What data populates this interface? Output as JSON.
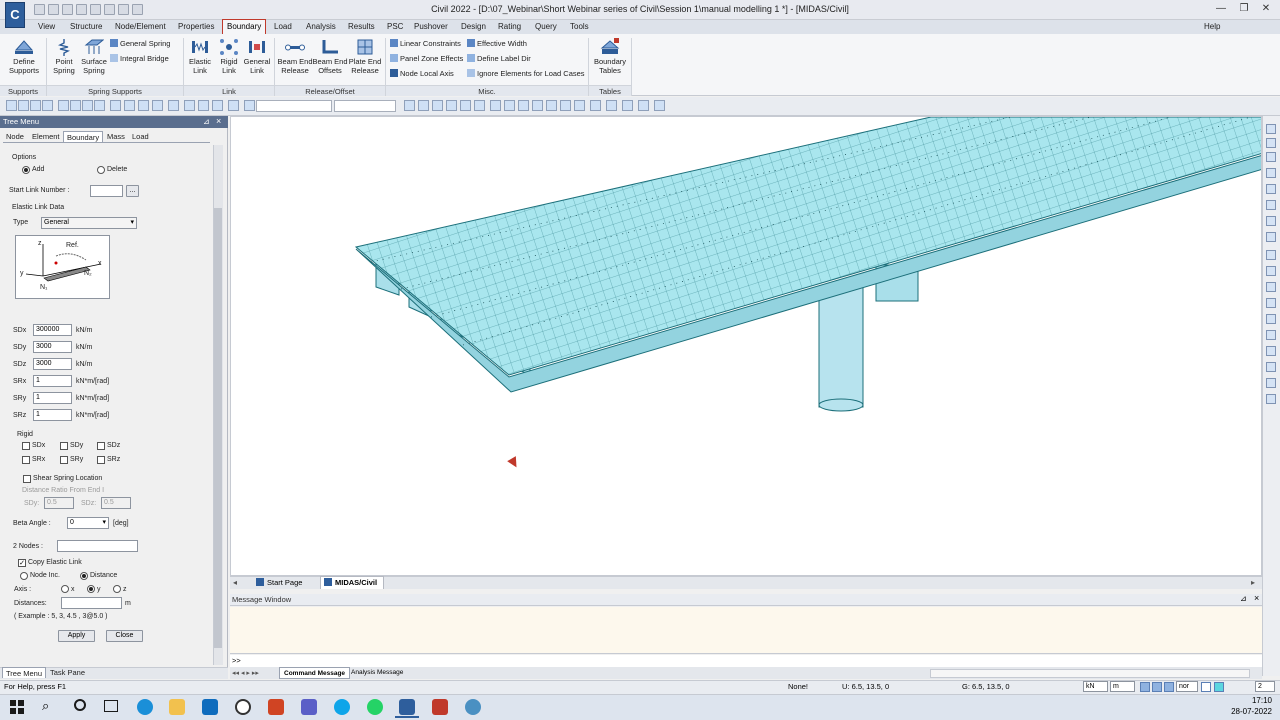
{
  "window": {
    "title": "Civil 2022 - [D:\\07_Webinar\\Short Webinar series of Civil\\Session 1\\manual modelling 1 *] - [MIDAS/Civil]",
    "logo": "C",
    "help": "Help"
  },
  "menu": [
    "View",
    "Structure",
    "Node/Element",
    "Properties",
    "Boundary",
    "Load",
    "Analysis",
    "Results",
    "PSC",
    "Pushover",
    "Design",
    "Rating",
    "Query",
    "Tools"
  ],
  "ribbon": {
    "supports": {
      "define": "Define Supports",
      "group": "Supports"
    },
    "spring": {
      "point": "Point Spring",
      "surface": "Surface Spring",
      "general": "General Spring",
      "integral": "Integral Bridge",
      "group": "Spring Supports"
    },
    "link": {
      "elastic": "Elastic Link",
      "rigid": "Rigid Link",
      "general": "General Link",
      "group": "Link"
    },
    "release": {
      "beam": "Beam End Release",
      "offsets": "Beam End Offsets",
      "plate": "Plate End Release",
      "group": "Release/Offset"
    },
    "misc": {
      "linear": "Linear Constraints",
      "panel": "Panel Zone Effects",
      "nodelocal": "Node Local Axis",
      "effective": "Effective Width",
      "labeldir": "Define Label Dir",
      "ignore": "Ignore Elements for Load Cases",
      "group": "Misc."
    },
    "tables": {
      "label": "Boundary Tables",
      "group": "Tables"
    }
  },
  "tree": {
    "header": "Tree Menu",
    "tabs": [
      "Node",
      "Element",
      "Boundary",
      "Mass",
      "Load"
    ],
    "options": "Options",
    "add": "Add",
    "delete": "Delete",
    "start_link": "Start Link Number :",
    "elastic_data": "Elastic Link Data",
    "type_label": "Type",
    "type_value": "General",
    "fig": {
      "ref": "Ref.",
      "z": "z",
      "y": "y",
      "x": "x",
      "n1": "N₁",
      "n2": "N₂"
    },
    "springs": [
      {
        "label": "SDx",
        "value": "300000",
        "unit": "kN/m"
      },
      {
        "label": "SDy",
        "value": "3000",
        "unit": "kN/m"
      },
      {
        "label": "SDz",
        "value": "3000",
        "unit": "kN/m"
      },
      {
        "label": "SRx",
        "value": "1",
        "unit": "kN*m/[rad]"
      },
      {
        "label": "SRy",
        "value": "1",
        "unit": "kN*m/[rad]"
      },
      {
        "label": "SRz",
        "value": "1",
        "unit": "kN*m/[rad]"
      }
    ],
    "rigid": "Rigid",
    "rigid_items": [
      "SDx",
      "SDy",
      "SDz",
      "SRx",
      "SRy",
      "SRz"
    ],
    "shear": "Shear Spring Location",
    "dist_ratio": "Distance Ratio From End I",
    "sdy": "SDy:",
    "sdz": "SDz:",
    "sdy_val": "0.5",
    "sdz_val": "0.5",
    "beta_label": "Beta Angle :",
    "beta_value": "0",
    "beta_unit": "[deg]",
    "nodes_label": "2 Nodes :",
    "copy": "Copy Elastic Link",
    "node_inc": "Node Inc.",
    "distance": "Distance",
    "axis_label": "Axis :",
    "ax": "x",
    "ay": "y",
    "az": "z",
    "distances_label": "Distances:",
    "distances_unit": "m",
    "example": "( Example :   5, 3, 4.5 , 3@5.0 )",
    "apply": "Apply",
    "close": "Close",
    "bottom_tabs": [
      "Tree Menu",
      "Task Pane"
    ]
  },
  "doc_tabs": [
    "Start Page",
    "MIDAS/Civil"
  ],
  "message": {
    "title": "Message Window",
    "prompt": ">>",
    "tabs": [
      "Command Message",
      "Analysis Message"
    ]
  },
  "status": {
    "help": "For Help, press F1",
    "none": "None!",
    "u": "U: 6.5, 13.5, 0",
    "g": "G: 6.5, 13.5, 0",
    "unit_force": "kN",
    "unit_len": "m",
    "mode": "nor",
    "page": "2"
  },
  "clock": {
    "time": "17:10",
    "date": "28-07-2022"
  },
  "colors": {
    "deck": "#a9e6ee",
    "deck_line": "#1c6f7a",
    "accent": "#c0392b"
  }
}
